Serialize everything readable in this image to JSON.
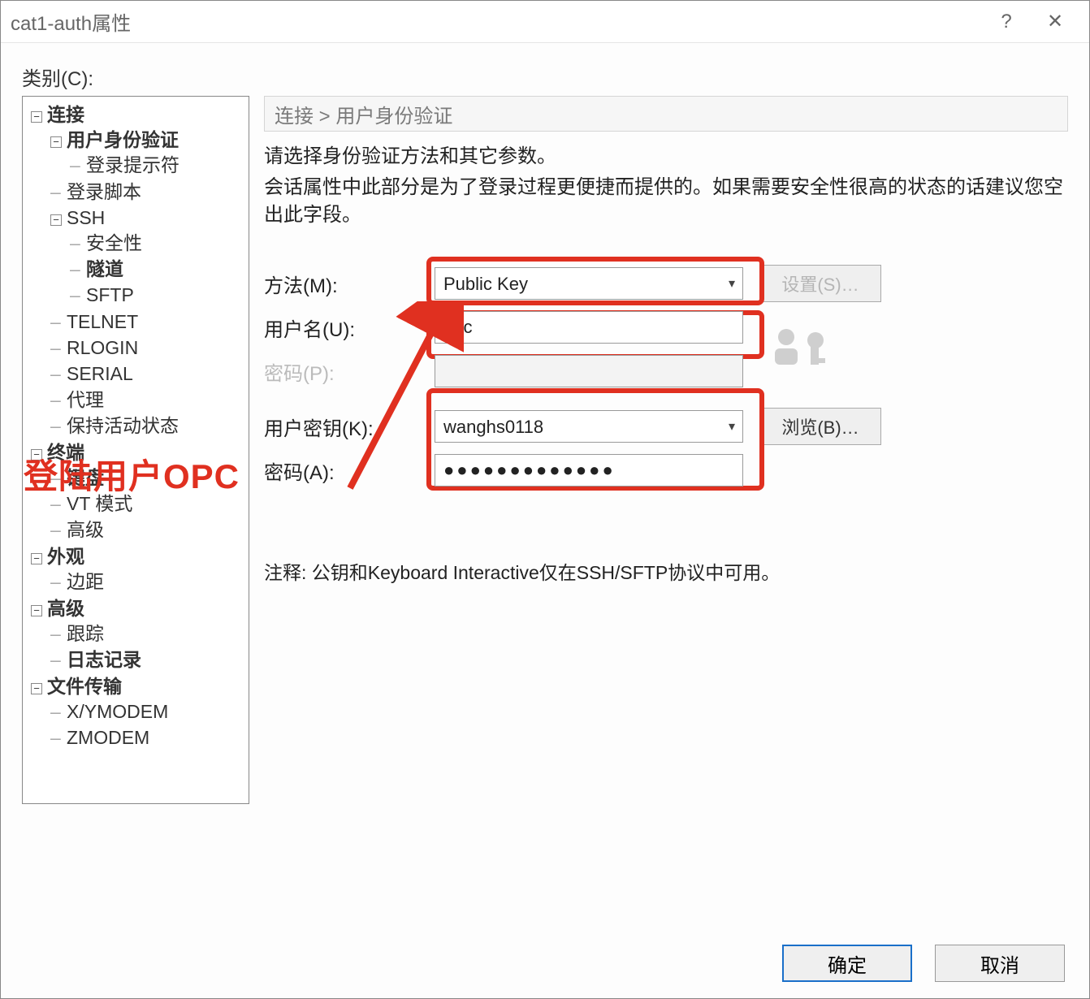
{
  "window": {
    "title": "cat1-auth属性"
  },
  "category_label": "类别(C):",
  "tree": {
    "connection": "连接",
    "user_auth": "用户身份验证",
    "login_prompt": "登录提示符",
    "login_script": "登录脚本",
    "ssh": "SSH",
    "security": "安全性",
    "tunnel": "隧道",
    "sftp": "SFTP",
    "telnet": "TELNET",
    "rlogin": "RLOGIN",
    "serial": "SERIAL",
    "proxy": "代理",
    "keepalive": "保持活动状态",
    "terminal": "终端",
    "keyboard": "键盘",
    "vtmode": "VT 模式",
    "advanced_terminal": "高级",
    "appearance": "外观",
    "margin": "边距",
    "advanced": "高级",
    "trace": "跟踪",
    "logging": "日志记录",
    "filetransfer": "文件传输",
    "xymodem": "X/YMODEM",
    "zmodem": "ZMODEM"
  },
  "breadcrumb": "连接  >  用户身份验证",
  "desc_line1": "请选择身份验证方法和其它参数。",
  "desc_line2": "会话属性中此部分是为了登录过程更便捷而提供的。如果需要安全性很高的状态的话建议您空出此字段。",
  "form": {
    "method_label": "方法(M):",
    "method_value": "Public Key",
    "username_label": "用户名(U):",
    "username_value": "opc",
    "password_label": "密码(P):",
    "password_value": "",
    "userkey_label": "用户密钥(K):",
    "userkey_value": "wanghs0118",
    "passphrase_label": "密码(A):",
    "passphrase_value": "●●●●●●●●●●●●●",
    "settings_btn": "设置(S)…",
    "browse_btn": "浏览(B)…"
  },
  "note": "注释: 公钥和Keyboard Interactive仅在SSH/SFTP协议中可用。",
  "annotation": "登陆用户OPC",
  "footer": {
    "ok": "确定",
    "cancel": "取消"
  }
}
